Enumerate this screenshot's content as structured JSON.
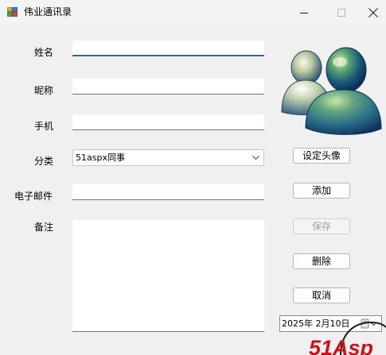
{
  "window": {
    "title": "伟业通讯录",
    "icon": "address-book-icon",
    "controls": [
      "minimize-icon",
      "maximize-icon",
      "close-icon"
    ]
  },
  "form": {
    "name_label": "姓名",
    "nickname_label": "昵称",
    "phone_label": "手机",
    "category_label": "分类",
    "email_label": "电子邮件",
    "note_label": "备注",
    "name_value": "",
    "nickname_value": "",
    "phone_value": "",
    "email_value": "",
    "note_value": "",
    "category_value": "51aspx同事"
  },
  "buttons": {
    "set_avatar": "设定头像",
    "add": "添加",
    "save": "保存",
    "delete": "删除",
    "cancel": "取消"
  },
  "date": {
    "value": "2025年  2月10日"
  },
  "avatar": {
    "icon": "msn-buddy-avatar"
  },
  "watermark": {
    "text": "51Asp"
  },
  "colors": {
    "focus_underline": "#1f6f9c",
    "watermark_red": "#c8141e",
    "disabled_text": "#a0a0a0"
  }
}
